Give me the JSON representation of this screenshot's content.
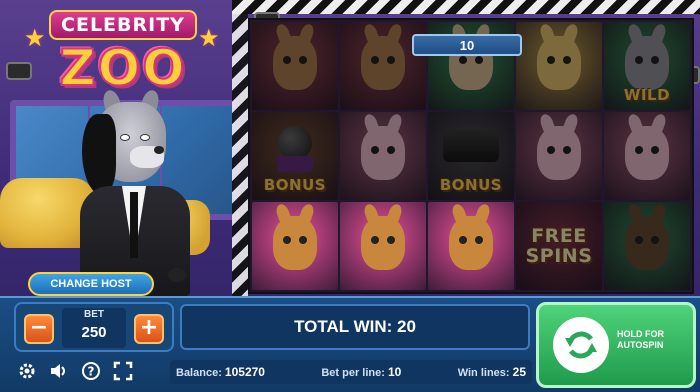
{
  "logo": {
    "line1": "CELEBRITY",
    "line2": "ZOO"
  },
  "win_badge": "10",
  "reels": [
    [
      {
        "symbol": "deer",
        "label": "",
        "bg": "#a03c4c",
        "fur": "#b37a3e",
        "dim": true
      },
      {
        "symbol": "deer",
        "label": "",
        "bg": "#a03c4c",
        "fur": "#b37a3e",
        "dim": true
      },
      {
        "symbol": "bulldog",
        "label": "",
        "bg": "#2a9a4e",
        "fur": "#d9b98a",
        "dim": true
      },
      {
        "symbol": "lioness",
        "label": "",
        "bg": "#c9a23a",
        "fur": "#e9c15a",
        "dim": true
      },
      {
        "symbol": "wolf",
        "label": "WILD",
        "bg": "#2a8a4e",
        "fur": "#8f8f9c",
        "dim": true
      }
    ],
    [
      {
        "symbol": "microphone",
        "label": "BONUS",
        "bg": "#7a4a2a",
        "fur": "#444",
        "dim": true
      },
      {
        "symbol": "pig",
        "label": "",
        "bg": "#b35a7a",
        "fur": "#f2b6c8",
        "dim": true
      },
      {
        "symbol": "camera",
        "label": "BONUS",
        "bg": "#4a4a4a",
        "fur": "#333",
        "dim": true
      },
      {
        "symbol": "pig",
        "label": "",
        "bg": "#b35a7a",
        "fur": "#f2b6c8",
        "dim": true
      },
      {
        "symbol": "pig",
        "label": "",
        "bg": "#b35a7a",
        "fur": "#f2b6c8",
        "dim": true
      }
    ],
    [
      {
        "symbol": "deer",
        "label": "",
        "bg": "#e8509a",
        "fur": "#c9873e",
        "dim": false
      },
      {
        "symbol": "deer",
        "label": "",
        "bg": "#e8509a",
        "fur": "#c9873e",
        "dim": false
      },
      {
        "symbol": "deer",
        "label": "",
        "bg": "#e8509a",
        "fur": "#c9873e",
        "dim": false
      },
      {
        "symbol": "free-spins",
        "label": "FREE SPINS",
        "bg": "#8a3048",
        "fur": "",
        "dim": true
      },
      {
        "symbol": "bulldog",
        "label": "",
        "bg": "#2a8a4e",
        "fur": "#6a4a2a",
        "dim": true
      }
    ]
  ],
  "controls": {
    "change_host": "CHANGE HOST",
    "bet_label": "BET",
    "bet_value": "250",
    "minus": "−",
    "plus": "+",
    "total_win": "TOTAL WIN: 20",
    "autospin_hint": "HOLD FOR AUTOSPIN"
  },
  "stats": {
    "balance_label": "Balance:",
    "balance_value": "105270",
    "bet_per_line_label": "Bet per line:",
    "bet_per_line_value": "10",
    "win_lines_label": "Win lines:",
    "win_lines_value": "25"
  },
  "icons": [
    "gear-icon",
    "sound-icon",
    "help-icon",
    "fullscreen-icon",
    "autospin-icon"
  ]
}
